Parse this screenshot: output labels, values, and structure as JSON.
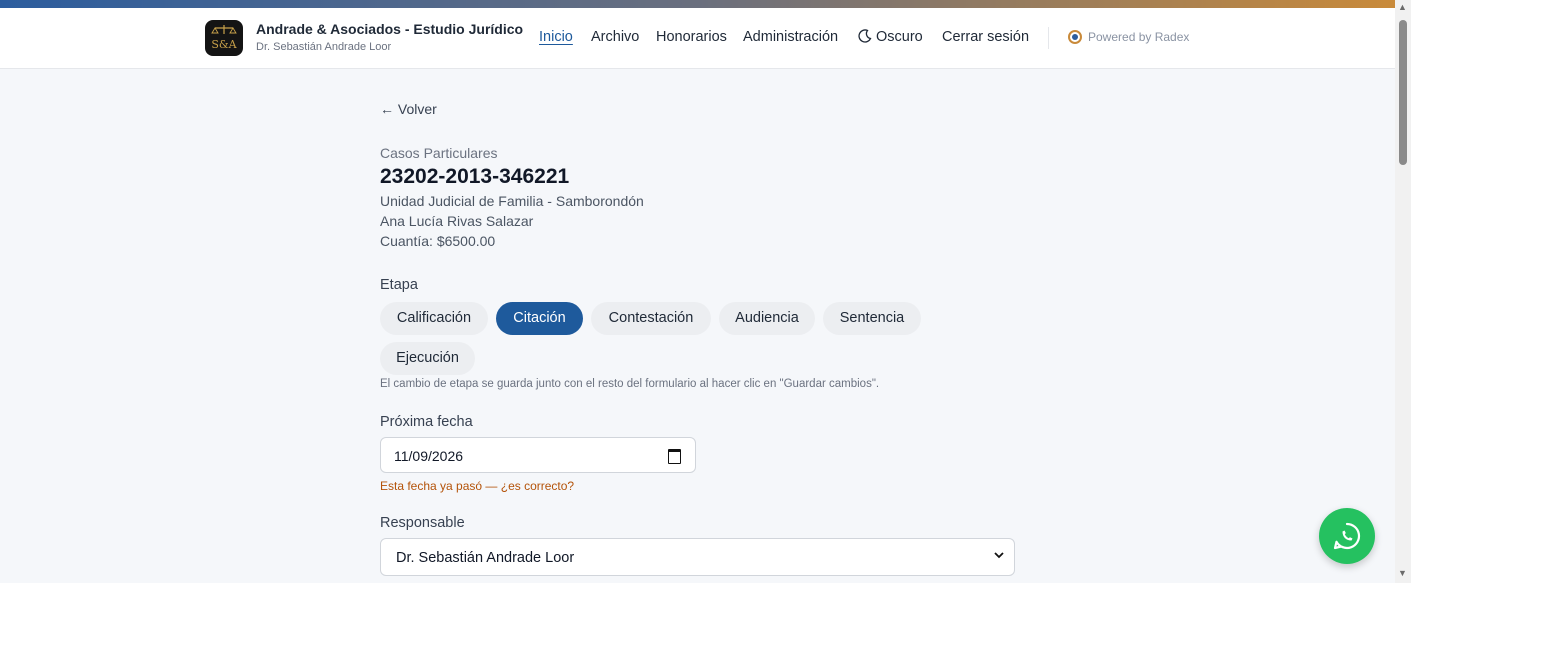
{
  "brand": {
    "title": "Andrade & Asociados - Estudio Jurídico",
    "subtitle": "Dr. Sebastián Andrade Loor",
    "logo_text": "S&A"
  },
  "nav": {
    "inicio": "Inicio",
    "archivo": "Archivo",
    "honorarios": "Honorarios",
    "administracion": "Administración",
    "oscuro": "Oscuro",
    "cerrar_sesion": "Cerrar sesión",
    "powered_by": "Powered by Radex",
    "active": "Inicio"
  },
  "page": {
    "back": "← Volver",
    "category": "Casos Particulares",
    "case_number": "23202-2013-346221",
    "court": "Unidad Judicial de Familia - Samborondón",
    "client": "Ana Lucía Rivas Salazar",
    "amount": "Cuantía: $6500.00"
  },
  "stage": {
    "label": "Etapa",
    "options": [
      "Calificación",
      "Citación",
      "Contestación",
      "Audiencia",
      "Sentencia",
      "Ejecución"
    ],
    "selected": "Citación",
    "note": "El cambio de etapa se guarda junto con el resto del formulario al hacer clic en \"Guardar cambios\"."
  },
  "next_date": {
    "label": "Próxima fecha",
    "value": "11/09/2026",
    "warning": "Esta fecha ya pasó — ¿es correcto?"
  },
  "responsible": {
    "label": "Responsable",
    "value": "Dr. Sebastián Andrade Loor"
  },
  "colors": {
    "primary": "#1e5a9c",
    "accent_gold": "#c98a3a",
    "whatsapp": "#25c160",
    "warning": "#b45309"
  },
  "icons": {
    "theme": "moon-icon",
    "powered": "radex-logo-icon",
    "calendar": "calendar-icon",
    "select": "chevron-down-icon",
    "chat": "whatsapp-icon"
  }
}
